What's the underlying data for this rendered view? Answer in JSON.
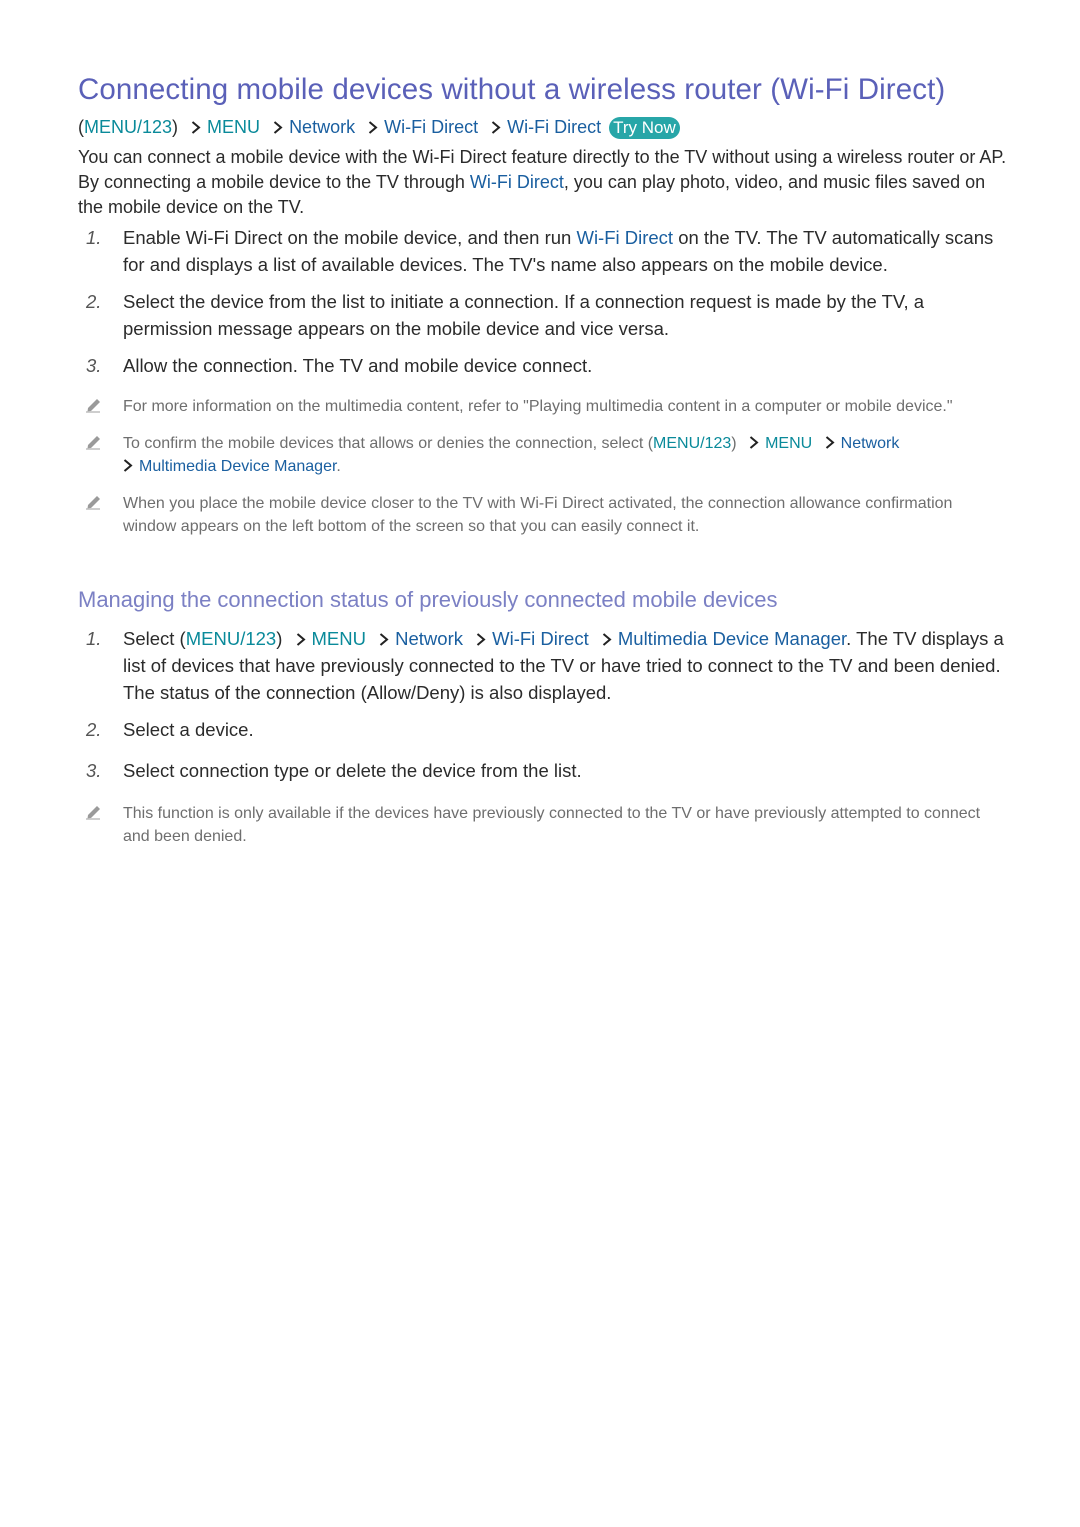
{
  "section1": {
    "title": "Connecting mobile devices without a wireless router (Wi-Fi Direct)",
    "path": {
      "open_paren": "(",
      "menu123": "MENU/123",
      "close_paren": ")",
      "menu": "MENU",
      "network": "Network",
      "wifi_direct_1": "Wi-Fi Direct",
      "wifi_direct_2": "Wi-Fi Direct",
      "try_now": "Try Now"
    },
    "intro": {
      "part1": "You can connect a mobile device with the Wi-Fi Direct feature directly to the TV without using a wireless router or AP. By connecting a mobile device to the TV through ",
      "link": "Wi-Fi Direct",
      "part2": ", you can play photo, video, and music files saved on the mobile device on the TV."
    },
    "steps": [
      {
        "num": "1.",
        "before": "Enable Wi-Fi Direct on the mobile device, and then run ",
        "link": "Wi-Fi Direct",
        "after": " on the TV. The TV automatically scans for and displays a list of available devices. The TV's name also appears on the mobile device."
      },
      {
        "num": "2.",
        "text": "Select the device from the list to initiate a connection. If a connection request is made by the TV, a permission message appears on the mobile device and vice versa."
      },
      {
        "num": "3.",
        "text": "Allow the connection. The TV and mobile device connect."
      }
    ],
    "notes": [
      {
        "text": "For more information on the multimedia content, refer to \"Playing multimedia content in a computer or mobile device.\""
      },
      {
        "before": "To confirm the mobile devices that allows or denies the connection, select (",
        "menu123": "MENU/123",
        "close_paren": ")",
        "menu": "MENU",
        "network": "Network",
        "manager": "Multimedia Device Manager",
        "after": "."
      },
      {
        "text": "When you place the mobile device closer to the TV with Wi-Fi Direct activated, the connection allowance confirmation window appears on the left bottom of the screen so that you can easily connect it."
      }
    ]
  },
  "section2": {
    "title": "Managing the connection status of previously connected mobile devices",
    "steps": [
      {
        "num": "1.",
        "before": "Select (",
        "menu123": "MENU/123",
        "close_paren": ")",
        "menu": "MENU",
        "network": "Network",
        "wifi_direct": "Wi-Fi Direct",
        "manager": "Multimedia Device Manager",
        "after": ". The TV displays a list of devices that have previously connected to the TV or have tried to connect to the TV and been denied. The status of the connection (Allow/Deny) is also displayed."
      },
      {
        "num": "2.",
        "text": "Select a device."
      },
      {
        "num": "3.",
        "text": "Select connection type or delete the device from the list."
      }
    ],
    "notes": [
      {
        "text": "This function is only available if the devices have previously connected to the TV or have previously attempted to connect and been denied."
      }
    ]
  },
  "colors": {
    "heading": "#5a60b8",
    "subheading": "#7b80c4",
    "menu": "#0a8a9a",
    "link": "#1a5fa0",
    "try_now_bg": "#27a6a8",
    "note_text": "#6e6e6e"
  }
}
